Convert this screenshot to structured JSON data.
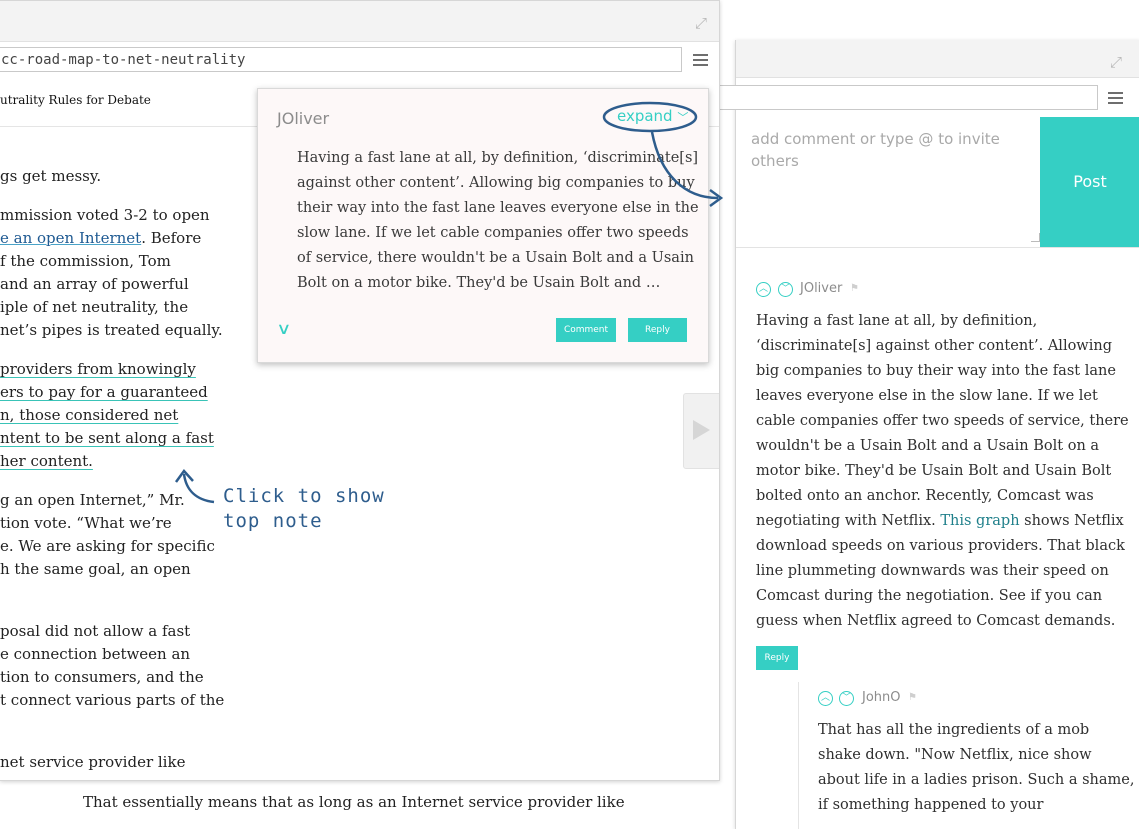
{
  "left_window": {
    "url": "cc-road-map-to-net-neutrality",
    "page_heading": "utrality Rules for Debate",
    "article_lines": [
      "gs get messy.",
      "mmission voted 3-2 to open",
      "e an open Internet. Before",
      "f the commission, Tom",
      "and an array of powerful",
      "iple of net neutrality, the",
      "net’s pipes is treated equally.",
      "providers from knowingly",
      "ers to pay for a guaranteed",
      "n, those considered net",
      "ntent to be sent along a fast",
      "her content.",
      "g an open Internet,” Mr.",
      "tion vote. “What we’re",
      "e. We are asking for specific",
      "h the same goal, an open",
      "posal did not allow a fast",
      "e connection between an",
      "tion to consumers, and the",
      "t connect various parts of the",
      "net service provider like"
    ],
    "link_text": "e an open Internet",
    "bottom_line": "That essentially means that as long as an Internet service provider like"
  },
  "popup": {
    "author": "JOliver",
    "expand_label": "expand",
    "text_lines": [
      "Having a fast lane at all, by definition, ‘discriminate[s]",
      "against other content’. Allowing big companies to buy",
      "their way into the fast lane leaves everyone else in the",
      "slow lane. If we let cable companies offer two speeds",
      "of service, there wouldn't be a Usain Bolt and a Usain",
      "Bolt on a motor bike. They'd be Usain Bolt and …"
    ],
    "comment_button": "Comment",
    "reply_button": "Reply"
  },
  "annotation": {
    "line1": "Click to show",
    "line2": "top note"
  },
  "right_window": {
    "comment_placeholder": "add comment or type @ to invite others",
    "post_button": "Post",
    "comment1": {
      "author": "JOliver",
      "lines": [
        "Having a fast lane at all, by definition,",
        "‘discriminate[s] against other content’. Allowing",
        "big companies to buy their way into the fast lane",
        "leaves everyone else in the slow lane. If we let",
        "cable companies offer two speeds of service, there",
        "wouldn't be a Usain Bolt and a Usain Bolt on a",
        "motor bike. They'd be Usain Bolt and Usain Bolt",
        "bolted onto an anchor. Recently, Comcast was",
        "negotiating with Netflix.",
        "download speeds on various providers. That black",
        "line plummeting downwards was their speed on",
        "Comcast during the negotiation. See if you can",
        "guess when Netflix agreed to Comcast demands."
      ],
      "link_text": "This graph",
      "after_link": " shows Netflix",
      "reply_button": "Reply"
    },
    "comment2": {
      "author": "JohnO",
      "lines": [
        "That has all the ingredients of a mob",
        "shake down. \"Now Netflix, nice show",
        "about life in a ladies prison. Such a shame,",
        "if something happened to your"
      ]
    }
  },
  "colors": {
    "accent": "#35cfc4",
    "link": "#1f5a92",
    "annotation": "#2e5d8d"
  }
}
